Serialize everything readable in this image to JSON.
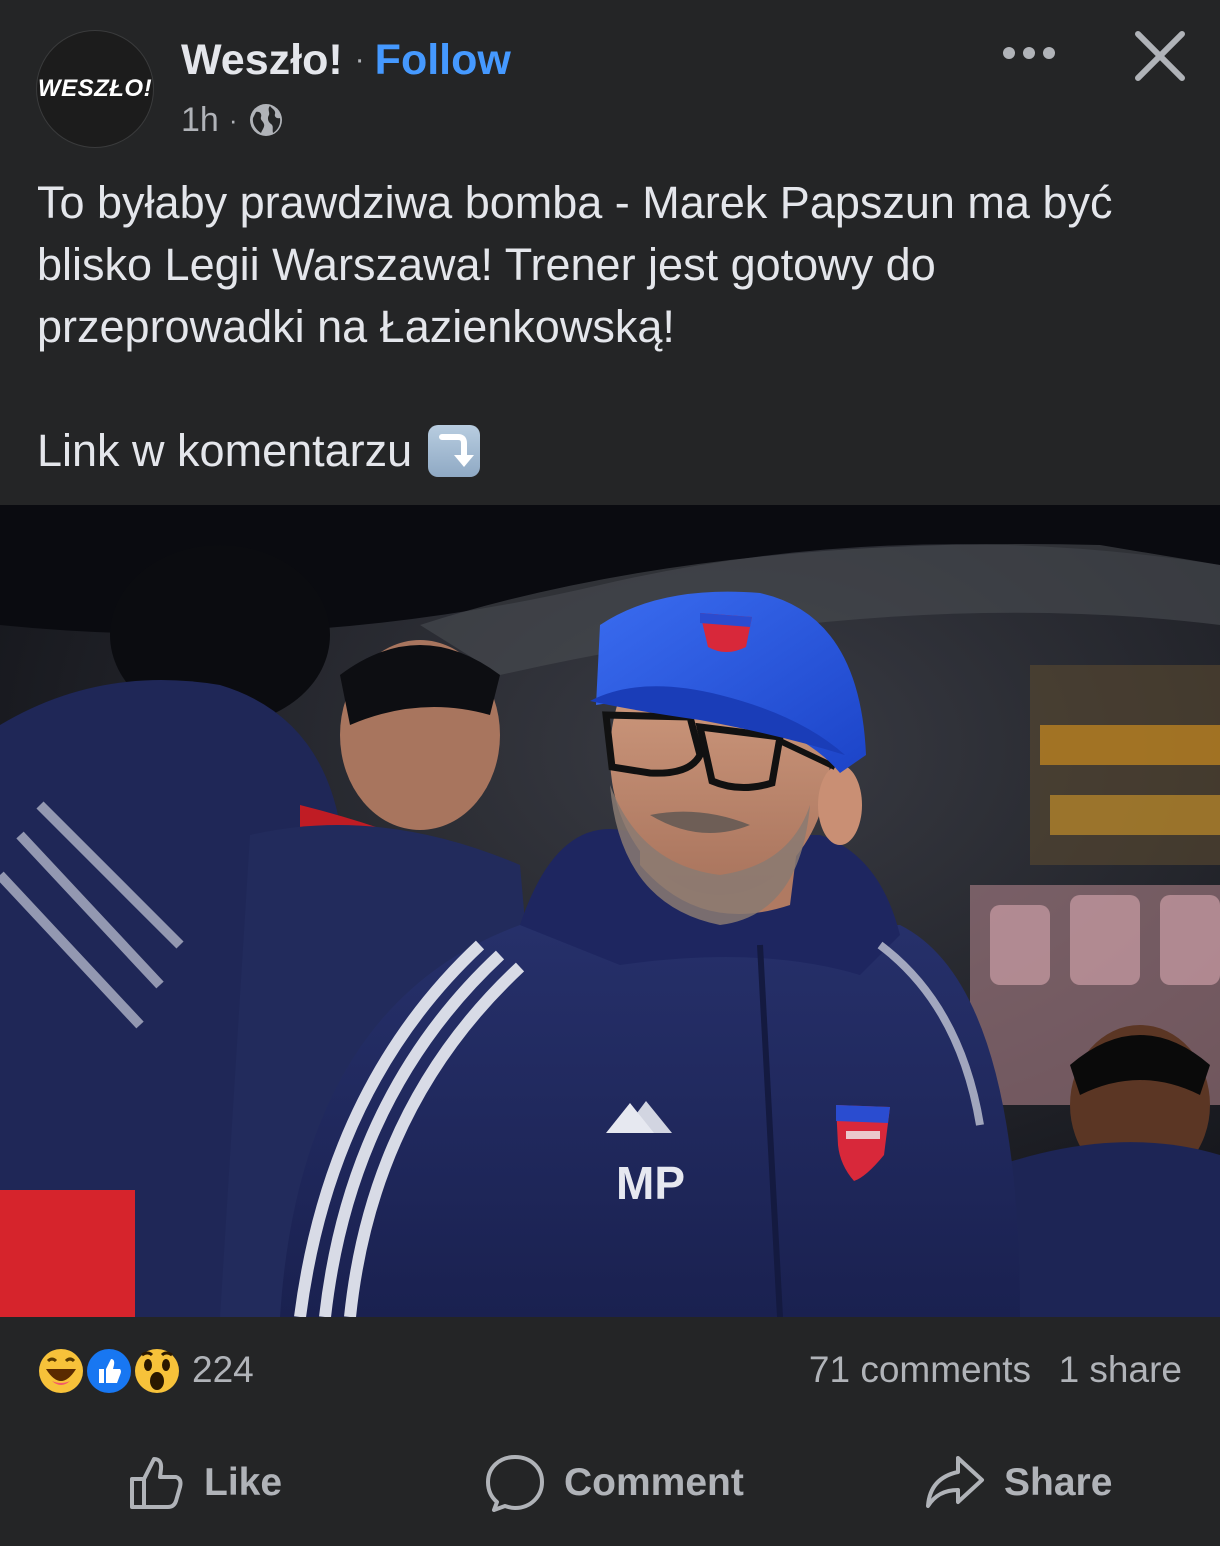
{
  "header": {
    "page_name": "Weszło!",
    "separator": "·",
    "follow_label": "Follow",
    "timestamp": "1h",
    "meta_separator": "·",
    "audience_icon": "globe-icon",
    "avatar_text": "WESZŁO!",
    "more_icon": "more-options-icon",
    "close_icon": "close-icon"
  },
  "post": {
    "text_line_1": "To byłaby prawdziwa bomba - Marek Papszun ma być blisko Legii Warszawa! Trener jest gotowy do przeprowadki na Łazienkowską!",
    "text_line_2": "Link w komentarzu",
    "emoji": "arrow-down-right-emoji",
    "photo": {
      "jacket_initials": "MP",
      "description_icon": "coach-photo"
    }
  },
  "stats": {
    "reactions": [
      "haha",
      "like",
      "wow"
    ],
    "reaction_count": "224",
    "comments": "71 comments",
    "shares": "1 share"
  },
  "actions": {
    "like_label": "Like",
    "comment_label": "Comment",
    "share_label": "Share"
  },
  "colors": {
    "background": "#242526",
    "text": "#e4e6eb",
    "secondary_text": "#b0b3b8",
    "link_blue": "#4599ff"
  }
}
